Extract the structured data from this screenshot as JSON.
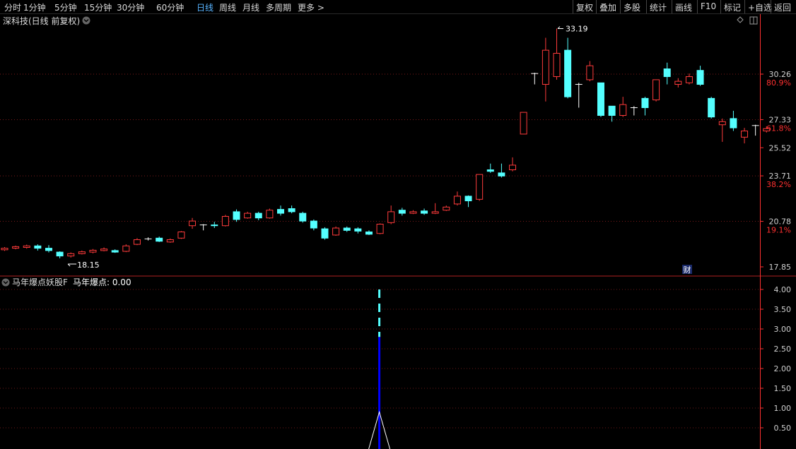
{
  "toolbar": {
    "periods": [
      "分时",
      "1分钟",
      "5分钟",
      "15分钟",
      "30分钟",
      "60分钟",
      "日线",
      "周线",
      "月线",
      "多周期",
      "更多 >"
    ],
    "active_period": "日线",
    "actions": [
      "复权",
      "叠加",
      "多股",
      "统计",
      "画线",
      "F10",
      "标记",
      "+自选",
      "返回"
    ]
  },
  "main_panel": {
    "title": "深科技(日线 前复权)",
    "high_marker": "33.19",
    "low_marker": "18.15",
    "event_badge": "财"
  },
  "indicator_panel": {
    "title": "马年爆点妖股F",
    "label": "马年爆点: 0.00"
  },
  "colors": {
    "up": "#ff3b3b",
    "down": "#54ffff",
    "doji": "#ffffff",
    "axis_red": "#ff3030",
    "indicator_line": "#0000ff",
    "dash": "#54ffff",
    "background": "#000000"
  },
  "chart_data": [
    {
      "type": "candlestick",
      "title": "深科技(日线 前复权)",
      "y_axis_right": {
        "prices": [
          "30.26",
          "27.33",
          "25.52",
          "23.71",
          "20.78",
          "17.85"
        ],
        "percents": [
          {
            "price": 30.26,
            "label": "80.9%"
          },
          {
            "price": 27.33,
            "label": "61.8%"
          },
          {
            "price": 23.71,
            "label": "38.2%"
          },
          {
            "price": 20.78,
            "label": "19.1%"
          }
        ]
      },
      "gridlines": [
        30.26,
        27.33,
        23.71,
        20.78
      ],
      "candles": [
        {
          "o": 18.95,
          "c": 19.05,
          "h": 19.12,
          "l": 18.88,
          "up": true
        },
        {
          "o": 19.05,
          "c": 19.15,
          "h": 19.22,
          "l": 18.98,
          "up": true
        },
        {
          "o": 19.1,
          "c": 19.2,
          "h": 19.28,
          "l": 19.02,
          "up": true
        },
        {
          "o": 19.2,
          "c": 19.05,
          "h": 19.3,
          "l": 18.9,
          "up": false
        },
        {
          "o": 19.05,
          "c": 18.9,
          "h": 19.25,
          "l": 18.78,
          "up": false
        },
        {
          "o": 18.8,
          "c": 18.55,
          "h": 18.85,
          "l": 18.4,
          "up": false
        },
        {
          "o": 18.55,
          "c": 18.7,
          "h": 18.78,
          "l": 18.45,
          "up": true
        },
        {
          "o": 18.7,
          "c": 18.82,
          "h": 18.9,
          "l": 18.65,
          "up": true
        },
        {
          "o": 18.8,
          "c": 18.92,
          "h": 19.0,
          "l": 18.72,
          "up": true
        },
        {
          "o": 18.9,
          "c": 19.0,
          "h": 19.1,
          "l": 18.85,
          "up": true
        },
        {
          "o": 18.9,
          "c": 18.8,
          "h": 18.98,
          "l": 18.75,
          "up": false
        },
        {
          "o": 18.85,
          "c": 19.2,
          "h": 19.3,
          "l": 18.8,
          "up": true
        },
        {
          "o": 19.3,
          "c": 19.6,
          "h": 19.7,
          "l": 19.25,
          "up": true
        },
        {
          "o": 19.65,
          "c": 19.65,
          "h": 19.75,
          "l": 19.55,
          "doji": true
        },
        {
          "o": 19.7,
          "c": 19.5,
          "h": 19.8,
          "l": 19.45,
          "up": false
        },
        {
          "o": 19.45,
          "c": 19.6,
          "h": 19.68,
          "l": 19.4,
          "up": true
        },
        {
          "o": 19.7,
          "c": 20.1,
          "h": 20.15,
          "l": 19.65,
          "up": true
        },
        {
          "o": 20.5,
          "c": 20.8,
          "h": 21.0,
          "l": 20.3,
          "up": true
        },
        {
          "o": 20.55,
          "c": 20.55,
          "h": 20.6,
          "l": 20.2,
          "doji": true
        },
        {
          "o": 20.55,
          "c": 20.5,
          "h": 20.75,
          "l": 20.35,
          "up": false
        },
        {
          "o": 20.5,
          "c": 21.1,
          "h": 21.2,
          "l": 20.45,
          "up": true
        },
        {
          "o": 21.4,
          "c": 20.9,
          "h": 21.55,
          "l": 20.75,
          "up": false
        },
        {
          "o": 21.0,
          "c": 21.3,
          "h": 21.4,
          "l": 20.95,
          "up": true
        },
        {
          "o": 21.3,
          "c": 21.0,
          "h": 21.4,
          "l": 20.85,
          "up": false
        },
        {
          "o": 21.0,
          "c": 21.5,
          "h": 21.6,
          "l": 20.95,
          "up": true
        },
        {
          "o": 21.55,
          "c": 21.3,
          "h": 21.8,
          "l": 21.15,
          "up": false
        },
        {
          "o": 21.6,
          "c": 21.4,
          "h": 21.8,
          "l": 21.3,
          "up": false
        },
        {
          "o": 21.3,
          "c": 20.8,
          "h": 21.4,
          "l": 20.7,
          "up": false
        },
        {
          "o": 20.8,
          "c": 20.35,
          "h": 20.9,
          "l": 20.2,
          "up": false
        },
        {
          "o": 20.3,
          "c": 19.7,
          "h": 20.4,
          "l": 19.6,
          "up": false
        },
        {
          "o": 19.9,
          "c": 20.35,
          "h": 20.45,
          "l": 19.85,
          "up": true
        },
        {
          "o": 20.35,
          "c": 20.2,
          "h": 20.45,
          "l": 20.1,
          "up": false
        },
        {
          "o": 20.3,
          "c": 20.15,
          "h": 20.4,
          "l": 20.0,
          "up": false
        },
        {
          "o": 20.1,
          "c": 19.95,
          "h": 20.2,
          "l": 19.9,
          "up": false
        },
        {
          "o": 20.0,
          "c": 20.6,
          "h": 20.65,
          "l": 19.95,
          "up": true
        },
        {
          "o": 20.7,
          "c": 21.4,
          "h": 21.8,
          "l": 20.6,
          "up": true
        },
        {
          "o": 21.5,
          "c": 21.3,
          "h": 21.65,
          "l": 21.15,
          "up": false
        },
        {
          "o": 21.3,
          "c": 21.4,
          "h": 21.5,
          "l": 21.25,
          "up": true
        },
        {
          "o": 21.45,
          "c": 21.3,
          "h": 21.6,
          "l": 21.2,
          "up": false
        },
        {
          "o": 21.3,
          "c": 21.4,
          "h": 21.95,
          "l": 21.25,
          "up": true
        },
        {
          "o": 21.5,
          "c": 21.7,
          "h": 21.8,
          "l": 21.45,
          "up": true
        },
        {
          "o": 21.9,
          "c": 22.4,
          "h": 22.7,
          "l": 21.8,
          "up": true
        },
        {
          "o": 22.4,
          "c": 22.1,
          "h": 22.45,
          "l": 21.7,
          "up": false
        },
        {
          "o": 22.2,
          "c": 23.8,
          "h": 23.8,
          "l": 22.1,
          "up": true
        },
        {
          "o": 24.1,
          "c": 24.0,
          "h": 24.5,
          "l": 23.9,
          "up": false
        },
        {
          "o": 23.9,
          "c": 23.7,
          "h": 24.5,
          "l": 23.6,
          "up": false
        },
        {
          "o": 24.1,
          "c": 24.4,
          "h": 24.9,
          "l": 24.0,
          "up": true
        },
        {
          "o": 26.4,
          "c": 27.8,
          "h": 27.8,
          "l": 26.4,
          "up": true
        },
        {
          "o": 30.3,
          "c": 30.3,
          "h": 30.35,
          "l": 29.6,
          "doji": true
        },
        {
          "o": 29.6,
          "c": 31.8,
          "h": 32.6,
          "l": 28.5,
          "up": true
        },
        {
          "o": 30.1,
          "c": 31.6,
          "h": 33.19,
          "l": 29.9,
          "up": true
        },
        {
          "o": 31.8,
          "c": 28.8,
          "h": 32.6,
          "l": 28.7,
          "up": false
        },
        {
          "o": 29.6,
          "c": 29.6,
          "h": 29.7,
          "l": 28.1,
          "doji": true
        },
        {
          "o": 29.9,
          "c": 30.8,
          "h": 31.1,
          "l": 29.8,
          "up": true
        },
        {
          "o": 29.7,
          "c": 27.6,
          "h": 29.7,
          "l": 27.5,
          "up": false
        },
        {
          "o": 28.2,
          "c": 27.6,
          "h": 28.2,
          "l": 27.2,
          "up": false
        },
        {
          "o": 27.6,
          "c": 28.3,
          "h": 28.8,
          "l": 27.5,
          "up": true
        },
        {
          "o": 28.1,
          "c": 28.1,
          "h": 28.2,
          "l": 27.6,
          "doji": true
        },
        {
          "o": 28.7,
          "c": 28.1,
          "h": 28.8,
          "l": 27.6,
          "up": false
        },
        {
          "o": 28.6,
          "c": 29.9,
          "h": 29.9,
          "l": 28.5,
          "up": true
        },
        {
          "o": 30.6,
          "c": 30.1,
          "h": 31.0,
          "l": 29.6,
          "up": false
        },
        {
          "o": 29.6,
          "c": 29.8,
          "h": 30.0,
          "l": 29.4,
          "up": true
        },
        {
          "o": 29.7,
          "c": 30.1,
          "h": 30.3,
          "l": 29.6,
          "up": true
        },
        {
          "o": 30.5,
          "c": 29.6,
          "h": 30.8,
          "l": 29.5,
          "up": false
        },
        {
          "o": 28.7,
          "c": 27.5,
          "h": 28.8,
          "l": 27.4,
          "up": false
        },
        {
          "o": 27.0,
          "c": 27.2,
          "h": 27.4,
          "l": 25.9,
          "up": true
        },
        {
          "o": 27.4,
          "c": 26.8,
          "h": 27.9,
          "l": 26.6,
          "up": false
        },
        {
          "o": 26.2,
          "c": 26.6,
          "h": 26.8,
          "l": 25.8,
          "up": true
        },
        {
          "o": 26.95,
          "c": 26.95,
          "h": 27.0,
          "l": 26.3,
          "doji": true
        },
        {
          "o": 26.6,
          "c": 26.75,
          "h": 26.9,
          "l": 26.5,
          "up": true
        }
      ]
    },
    {
      "type": "bar",
      "title": "马年爆点妖股F",
      "series_label": "马年爆点",
      "current_value": "0.00",
      "y_ticks": [
        "4.00",
        "3.50",
        "3.00",
        "2.50",
        "2.00",
        "1.50",
        "1.00",
        "0.50"
      ],
      "ylim": [
        0,
        4.4
      ],
      "signal": {
        "candle_index": 34,
        "solid_to": 2.8,
        "dashed_to": 4.0,
        "triangle_top": 0.9
      }
    }
  ]
}
